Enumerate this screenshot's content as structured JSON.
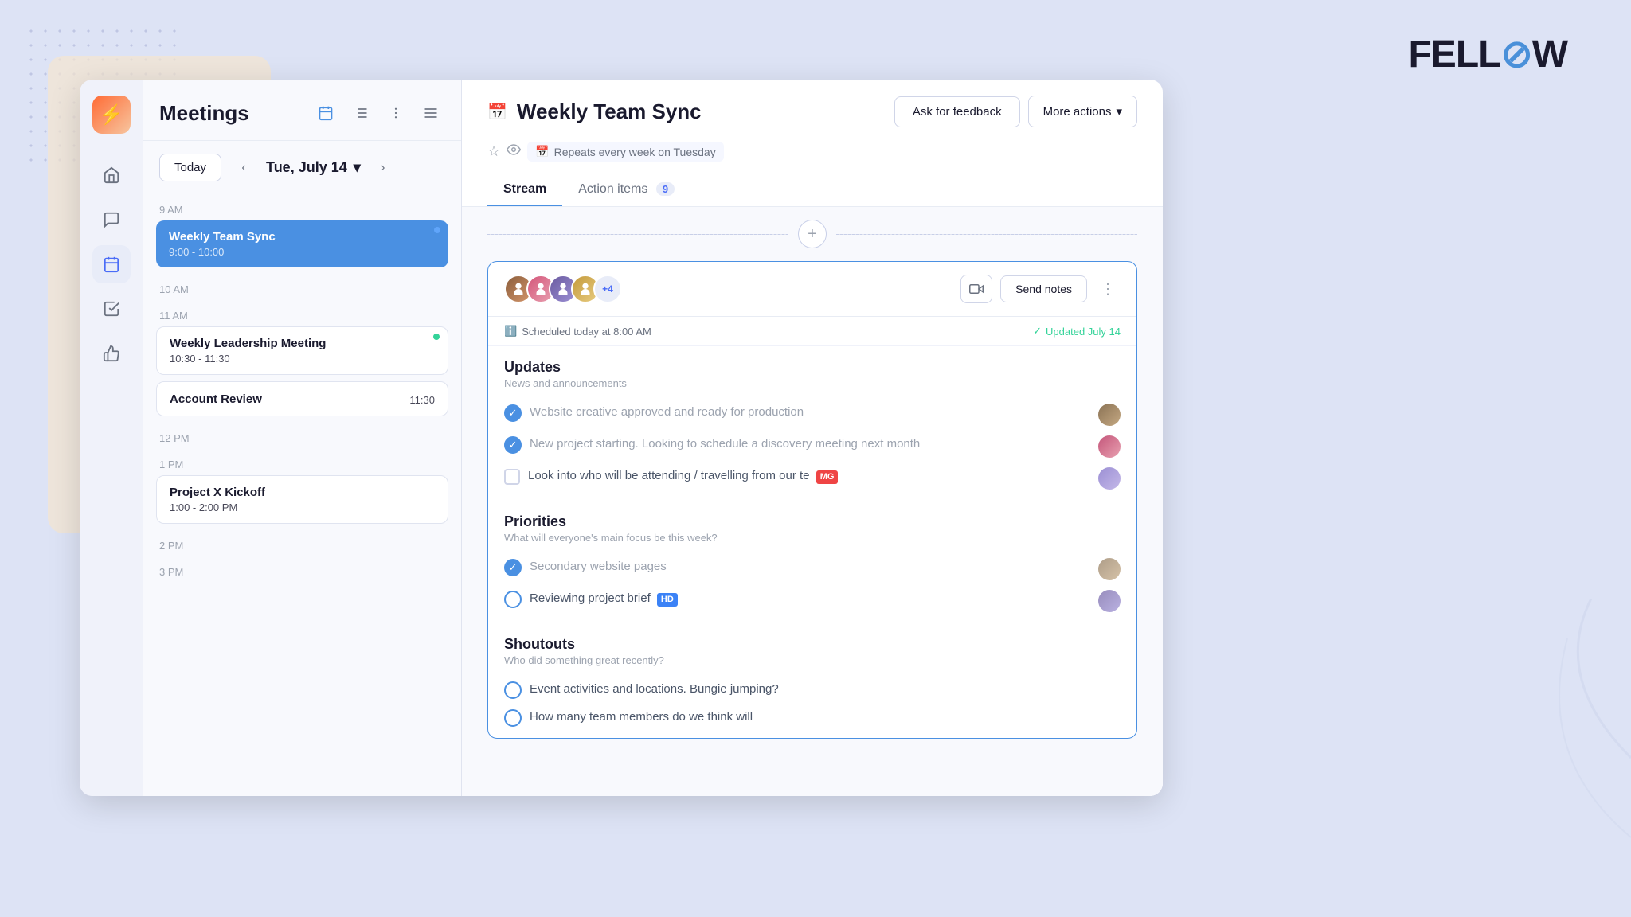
{
  "logo": {
    "text": "FELL",
    "accent": "W"
  },
  "sidebar": {
    "icons": [
      {
        "name": "home-icon",
        "symbol": "⌂",
        "active": false
      },
      {
        "name": "messages-icon",
        "symbol": "⟵",
        "active": false
      },
      {
        "name": "calendar-icon",
        "symbol": "▦",
        "active": true
      },
      {
        "name": "tasks-icon",
        "symbol": "☑",
        "active": false
      },
      {
        "name": "thumbs-icon",
        "symbol": "👍",
        "active": false
      }
    ]
  },
  "meetings": {
    "title": "Meetings",
    "today_label": "Today",
    "date": "Tue, July 14",
    "events": [
      {
        "time_label": "9 AM",
        "title": "Weekly Team Sync",
        "time": "9:00 - 10:00",
        "type": "blue",
        "dot": "blue-light"
      },
      {
        "time_label": "10 AM",
        "title": "",
        "time": "",
        "type": "spacer"
      },
      {
        "time_label": "11 AM",
        "title": "Weekly Leadership Meeting",
        "time": "10:30 - 11:30",
        "type": "white",
        "dot": "green"
      },
      {
        "time_label": "",
        "title": "Account Review",
        "time": "11:30",
        "type": "white",
        "dot": ""
      },
      {
        "time_label": "12 PM",
        "title": "",
        "time": "",
        "type": "spacer"
      },
      {
        "time_label": "1 PM",
        "title": "Project X Kickoff",
        "time": "1:00 - 2:00 PM",
        "type": "white",
        "dot": ""
      },
      {
        "time_label": "2 PM",
        "title": "",
        "time": "",
        "type": "spacer"
      },
      {
        "time_label": "3 PM",
        "title": "",
        "time": "",
        "type": "spacer"
      }
    ]
  },
  "main": {
    "meeting_title": "Weekly Team Sync",
    "repeat_text": "Repeats every week on Tuesday",
    "ask_feedback_label": "Ask for feedback",
    "more_actions_label": "More actions",
    "tabs": [
      {
        "id": "stream",
        "label": "Stream",
        "badge": null,
        "active": true
      },
      {
        "id": "action-items",
        "label": "Action items",
        "badge": "9",
        "active": false
      }
    ],
    "card": {
      "avatar_extra": "+4",
      "send_notes_label": "Send notes",
      "scheduled_text": "Scheduled today at 8:00 AM",
      "updated_text": "Updated July 14",
      "sections": [
        {
          "title": "Updates",
          "subtitle": "News and announcements",
          "items": [
            {
              "type": "checked-circle",
              "text": "Website creative approved and ready for production",
              "badge": null,
              "avatar": true
            },
            {
              "type": "checked-circle",
              "text": "New project starting. Looking to schedule a discovery meeting next month",
              "badge": null,
              "avatar": true
            },
            {
              "type": "checkbox",
              "text": "Look into who will be attending / travelling from our te",
              "badge": "MG",
              "avatar": true
            }
          ]
        },
        {
          "title": "Priorities",
          "subtitle": "What will everyone's main focus be this week?",
          "items": [
            {
              "type": "checked-circle",
              "text": "Secondary website pages",
              "badge": null,
              "avatar": true
            },
            {
              "type": "circle",
              "text": "Reviewing project brief",
              "badge": "HD",
              "avatar": true
            }
          ]
        },
        {
          "title": "Shoutouts",
          "subtitle": "Who did something great recently?",
          "items": [
            {
              "type": "circle",
              "text": "Event activities and locations. Bungie jumping?",
              "badge": null,
              "avatar": false
            },
            {
              "type": "circle",
              "text": "How many team members do we think will",
              "badge": null,
              "avatar": false
            }
          ]
        }
      ]
    }
  }
}
